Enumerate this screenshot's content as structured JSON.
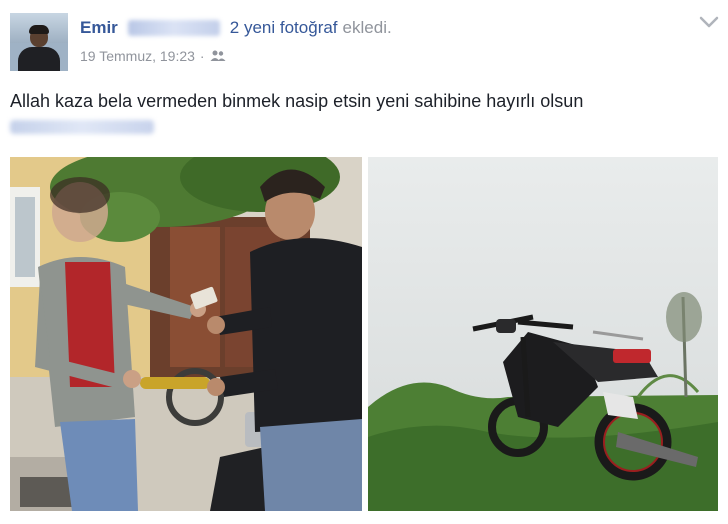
{
  "post": {
    "author_first_name": "Emir",
    "action_count_text": "2 yeni fotoğraf",
    "action_text": "ekledi.",
    "timestamp": "19 Temmuz, 19:23",
    "separator": "·",
    "audience_icon": "friends-icon",
    "options_icon": "chevron-down-icon",
    "body_text": "Allah kaza bela vermeden binmek nasip etsin yeni sahibine hayırlı olsun"
  },
  "colors": {
    "link_blue": "#365899",
    "meta_gray": "#90949c",
    "text_dark": "#1d2129"
  }
}
